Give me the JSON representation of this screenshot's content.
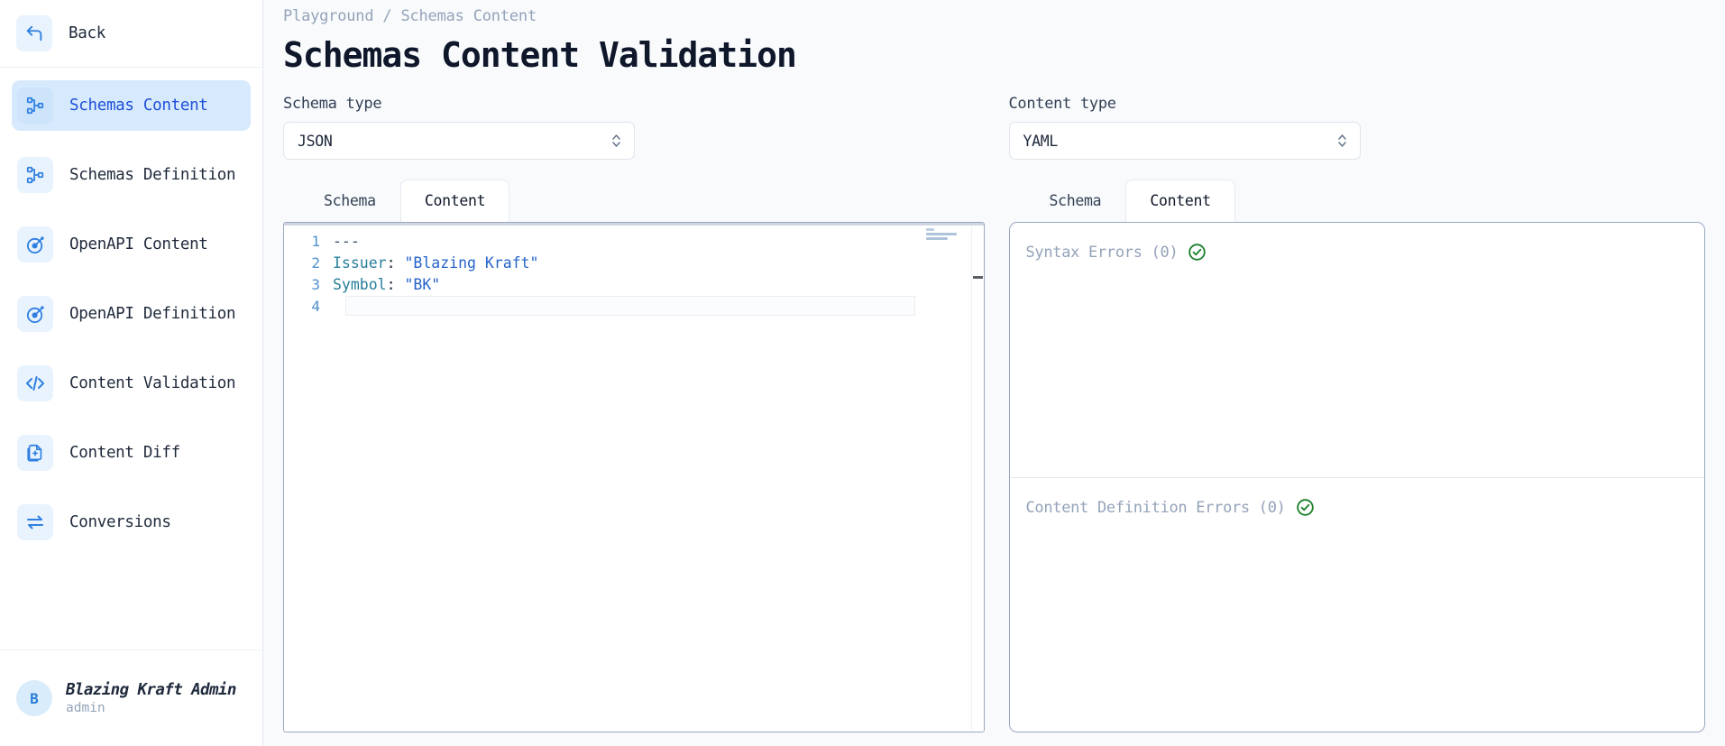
{
  "sidebar": {
    "back": {
      "label": "Back",
      "icon": "back-arrow-icon"
    },
    "items": [
      {
        "label": "Schemas Content",
        "icon": "schema-tree-icon",
        "active": true
      },
      {
        "label": "Schemas Definition",
        "icon": "schema-tree-icon",
        "active": false
      },
      {
        "label": "OpenAPI Content",
        "icon": "openapi-icon",
        "active": false
      },
      {
        "label": "OpenAPI Definition",
        "icon": "openapi-icon",
        "active": false
      },
      {
        "label": "Content Validation",
        "icon": "code-brackets-icon",
        "active": false
      },
      {
        "label": "Content Diff",
        "icon": "file-diff-icon",
        "active": false
      },
      {
        "label": "Conversions",
        "icon": "swap-arrows-icon",
        "active": false
      }
    ],
    "user": {
      "initial": "B",
      "name": "Blazing Kraft Admin",
      "role": "admin"
    }
  },
  "header": {
    "breadcrumb": "Playground / Schemas Content",
    "title": "Schemas Content Validation"
  },
  "left": {
    "field_label": "Schema type",
    "select_value": "JSON",
    "tabs": [
      {
        "label": "Schema",
        "active": false
      },
      {
        "label": "Content",
        "active": true
      }
    ],
    "editor": {
      "lines": [
        {
          "no": "1",
          "tokens": [
            {
              "text": "---",
              "cls": "tok-dash"
            }
          ]
        },
        {
          "no": "2",
          "tokens": [
            {
              "text": "Issuer",
              "cls": "tok-key"
            },
            {
              "text": ": ",
              "cls": "tok-punct"
            },
            {
              "text": "\"Blazing Kraft\"",
              "cls": "tok-str"
            }
          ]
        },
        {
          "no": "3",
          "tokens": [
            {
              "text": "Symbol",
              "cls": "tok-key"
            },
            {
              "text": ": ",
              "cls": "tok-punct"
            },
            {
              "text": "\"BK\"",
              "cls": "tok-str"
            }
          ]
        },
        {
          "no": "4",
          "tokens": [
            {
              "text": "",
              "cls": "tok-punct"
            }
          ]
        }
      ]
    }
  },
  "right": {
    "field_label": "Content type",
    "select_value": "YAML",
    "tabs": [
      {
        "label": "Schema",
        "active": false
      },
      {
        "label": "Content",
        "active": true
      }
    ],
    "results": [
      {
        "title": "Syntax Errors (0)",
        "status": "ok",
        "icon": "check-circle-icon"
      },
      {
        "title": "Content Definition Errors (0)",
        "status": "ok",
        "icon": "check-circle-icon"
      }
    ]
  },
  "colors": {
    "accent": "#2f7fe0",
    "active_bg": "#d7eafd",
    "icon_bg": "#e8f3fe",
    "success": "#1a7f29",
    "page_bg": "#f8fafc",
    "text": "#1e293b",
    "muted": "#94a3b8"
  }
}
